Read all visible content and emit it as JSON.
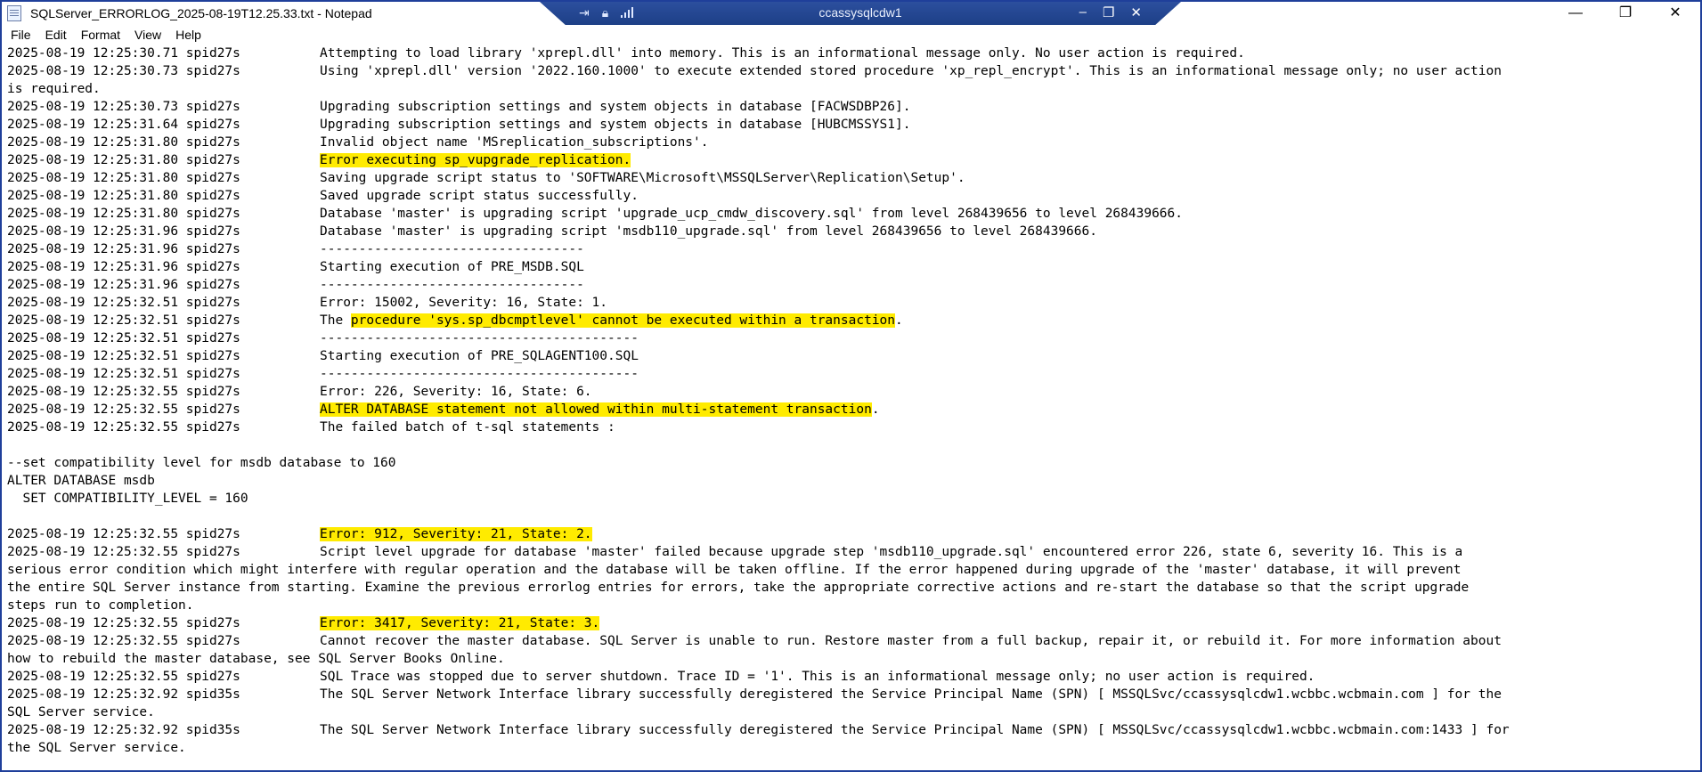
{
  "window": {
    "title": "SQLServer_ERRORLOG_2025-08-19T12.25.33.txt - Notepad",
    "icon": "notepad-icon",
    "controls": {
      "minimize": "—",
      "maximize": "❐",
      "close": "✕"
    }
  },
  "remote_session": {
    "name": "ccassysqlcdw1",
    "icons": [
      "pin-icon",
      "lock-icon",
      "signal-icon"
    ],
    "controls": {
      "minimize": "–",
      "restore": "❐",
      "close": "✕"
    }
  },
  "menu": [
    "File",
    "Edit",
    "Format",
    "View",
    "Help"
  ],
  "colors": {
    "highlight": "#ffeb00",
    "remote_bar": "#2c4f9e",
    "frame": "#1f3f9a"
  },
  "log": {
    "lines": [
      {
        "ts": "2025-08-19 12:25:30.71 spid27s",
        "msg": "Attempting to load library 'xprepl.dll' into memory. This is an informational message only. No user action is required."
      },
      {
        "ts": "2025-08-19 12:25:30.73 spid27s",
        "msg": "Using 'xprepl.dll' version '2022.160.1000' to execute extended stored procedure 'xp_repl_encrypt'. This is an informational message only; no user action"
      },
      {
        "cont": "is required."
      },
      {
        "ts": "2025-08-19 12:25:30.73 spid27s",
        "msg": "Upgrading subscription settings and system objects in database [FACWSDBP26]."
      },
      {
        "ts": "2025-08-19 12:25:31.64 spid27s",
        "msg": "Upgrading subscription settings and system objects in database [HUBCMSSYS1]."
      },
      {
        "ts": "2025-08-19 12:25:31.80 spid27s",
        "msg": "Invalid object name 'MSreplication_subscriptions'."
      },
      {
        "ts": "2025-08-19 12:25:31.80 spid27s",
        "hl": "Error executing sp_vupgrade_replication."
      },
      {
        "ts": "2025-08-19 12:25:31.80 spid27s",
        "msg": "Saving upgrade script status to 'SOFTWARE\\Microsoft\\MSSQLServer\\Replication\\Setup'."
      },
      {
        "ts": "2025-08-19 12:25:31.80 spid27s",
        "msg": "Saved upgrade script status successfully."
      },
      {
        "ts": "2025-08-19 12:25:31.80 spid27s",
        "msg": "Database 'master' is upgrading script 'upgrade_ucp_cmdw_discovery.sql' from level 268439656 to level 268439666."
      },
      {
        "ts": "2025-08-19 12:25:31.96 spid27s",
        "msg": "Database 'master' is upgrading script 'msdb110_upgrade.sql' from level 268439656 to level 268439666."
      },
      {
        "ts": "2025-08-19 12:25:31.96 spid27s",
        "msg": "----------------------------------"
      },
      {
        "ts": "2025-08-19 12:25:31.96 spid27s",
        "msg": "Starting execution of PRE_MSDB.SQL"
      },
      {
        "ts": "2025-08-19 12:25:31.96 spid27s",
        "msg": "----------------------------------"
      },
      {
        "ts": "2025-08-19 12:25:32.51 spid27s",
        "msg": "Error: 15002, Severity: 16, State: 1."
      },
      {
        "ts": "2025-08-19 12:25:32.51 spid27s",
        "pre": "The ",
        "hl": "procedure 'sys.sp_dbcmptlevel' cannot be executed within a transaction",
        "post": "."
      },
      {
        "ts": "2025-08-19 12:25:32.51 spid27s",
        "msg": "-----------------------------------------"
      },
      {
        "ts": "2025-08-19 12:25:32.51 spid27s",
        "msg": "Starting execution of PRE_SQLAGENT100.SQL"
      },
      {
        "ts": "2025-08-19 12:25:32.51 spid27s",
        "msg": "-----------------------------------------"
      },
      {
        "ts": "2025-08-19 12:25:32.55 spid27s",
        "msg": "Error: 226, Severity: 16, State: 6."
      },
      {
        "ts": "2025-08-19 12:25:32.55 spid27s",
        "hl": "ALTER DATABASE statement not allowed within multi-statement transaction",
        "post": "."
      },
      {
        "ts": "2025-08-19 12:25:32.55 spid27s",
        "msg": "The failed batch of t-sql statements :"
      },
      {
        "cont": ""
      },
      {
        "cont": "--set compatibility level for msdb database to 160"
      },
      {
        "cont": "ALTER DATABASE msdb"
      },
      {
        "cont": "  SET COMPATIBILITY_LEVEL = 160"
      },
      {
        "cont": ""
      },
      {
        "ts": "2025-08-19 12:25:32.55 spid27s",
        "hl": "Error: 912, Severity: 21, State: 2."
      },
      {
        "ts": "2025-08-19 12:25:32.55 spid27s",
        "msg": "Script level upgrade for database 'master' failed because upgrade step 'msdb110_upgrade.sql' encountered error 226, state 6, severity 16. This is a"
      },
      {
        "cont": "serious error condition which might interfere with regular operation and the database will be taken offline. If the error happened during upgrade of the 'master' database, it will prevent"
      },
      {
        "cont": "the entire SQL Server instance from starting. Examine the previous errorlog entries for errors, take the appropriate corrective actions and re-start the database so that the script upgrade"
      },
      {
        "cont": "steps run to completion."
      },
      {
        "ts": "2025-08-19 12:25:32.55 spid27s",
        "hl": "Error: 3417, Severity: 21, State: 3."
      },
      {
        "ts": "2025-08-19 12:25:32.55 spid27s",
        "msg": "Cannot recover the master database. SQL Server is unable to run. Restore master from a full backup, repair it, or rebuild it. For more information about"
      },
      {
        "cont": "how to rebuild the master database, see SQL Server Books Online."
      },
      {
        "ts": "2025-08-19 12:25:32.55 spid27s",
        "msg": "SQL Trace was stopped due to server shutdown. Trace ID = '1'. This is an informational message only; no user action is required."
      },
      {
        "ts": "2025-08-19 12:25:32.92 spid35s",
        "msg": "The SQL Server Network Interface library successfully deregistered the Service Principal Name (SPN) [ MSSQLSvc/ccassysqlcdw1.wcbbc.wcbmain.com ] for the"
      },
      {
        "cont": "SQL Server service."
      },
      {
        "ts": "2025-08-19 12:25:32.92 spid35s",
        "msg": "The SQL Server Network Interface library successfully deregistered the Service Principal Name (SPN) [ MSSQLSvc/ccassysqlcdw1.wcbbc.wcbmain.com:1433 ] for"
      },
      {
        "cont": "the SQL Server service."
      }
    ]
  }
}
